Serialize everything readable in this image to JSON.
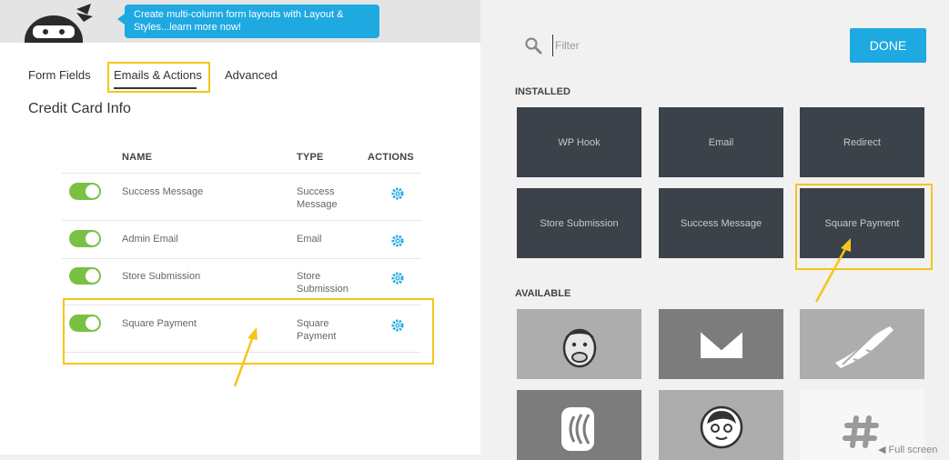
{
  "tooltip": {
    "text": "Create multi-column form layouts with Layout & Styles...learn more now!"
  },
  "tabs": {
    "form_fields": "Form Fields",
    "emails_actions": "Emails & Actions",
    "advanced": "Advanced"
  },
  "page_title": "Credit Card Info",
  "table": {
    "headers": {
      "name": "NAME",
      "type": "TYPE",
      "actions": "ACTIONS"
    },
    "rows": [
      {
        "name": "Success Message",
        "type_line1": "Success",
        "type_line2": "Message",
        "enabled": true
      },
      {
        "name": "Admin Email",
        "type_line1": "Email",
        "type_line2": "",
        "enabled": true
      },
      {
        "name": "Store Submission",
        "type_line1": "Store",
        "type_line2": "Submission",
        "enabled": true
      },
      {
        "name": "Square Payment",
        "type_line1": "Square",
        "type_line2": "Payment",
        "enabled": true
      }
    ]
  },
  "search": {
    "placeholder": "Filter"
  },
  "done_label": "DONE",
  "installed": {
    "label": "INSTALLED",
    "items": [
      "WP Hook",
      "Email",
      "Redirect",
      "Store Submission",
      "Success Message",
      "Square Payment"
    ]
  },
  "available": {
    "label": "AVAILABLE",
    "icons": [
      "mailchimp-icon",
      "envelope-icon",
      "grid-flag-icon",
      "signal-icon",
      "avatar-face-icon",
      "slack-icon"
    ]
  },
  "footer": {
    "fullscreen": "Full screen"
  },
  "colors": {
    "accent": "#1ea9e1",
    "toggle_on": "#7ac143",
    "highlight": "#f5c518",
    "tile_dark": "#3b4249"
  }
}
